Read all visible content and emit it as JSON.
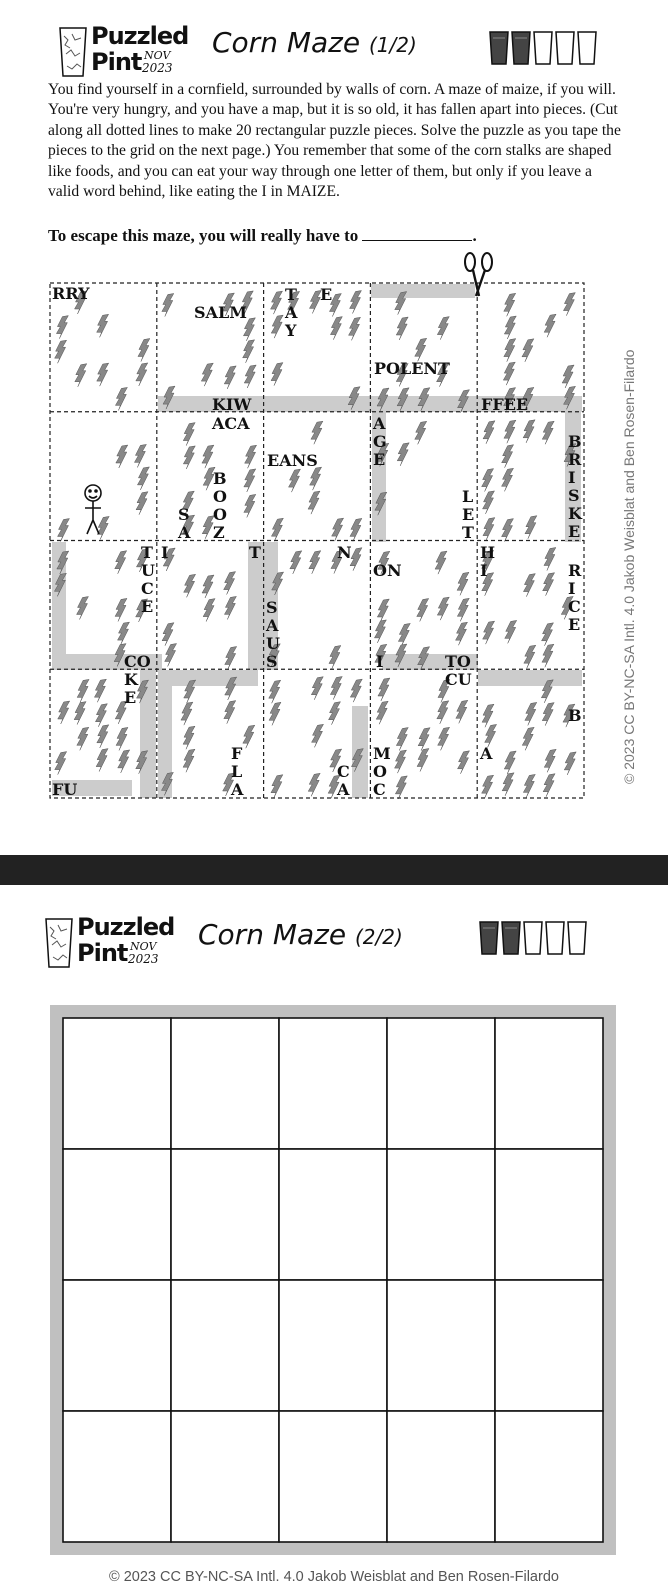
{
  "page1": {
    "logo": {
      "line1": "Puzzled",
      "line2": "Pint",
      "month": "NOV",
      "year": "2023"
    },
    "title": "Corn Maze",
    "part": "(1/2)",
    "difficulty": {
      "filled": 2,
      "total": 5
    },
    "intro": "You find yourself in a cornfield, surrounded by walls of corn. A maze of maize, if you will. You're very hungry, and you have a map, but it is so old, it has fallen apart into pieces. (Cut along all dotted lines to make 20 rectangular puzzle pieces. Solve the puzzle as you tape the pieces to the grid on the next page.) You remember that some of the corn stalks are shaped like foods, and you can eat your way through one letter of them, but only if you leave a valid word behind, like eating the I in MAIZE.",
    "tagline": "To escape this maze, you will really have to",
    "tagline_end": ".",
    "credit": "© 2023 CC BY-NC-SA Intl. 4.0  Jakob Weisblat and Ben Rosen-Filardo",
    "maze_words": {
      "r0c0": "RRY",
      "r0c1": "SALM",
      "r0c2_a": "T",
      "r0c2_b": "A",
      "r0c2_c": "Y",
      "r0c2_d": "E",
      "r0c3": "POLENT",
      "r0c3_b": "KIW",
      "r0c4": "FFEE",
      "r1c1": "ACA",
      "r1c2": "EANS",
      "r1c3_a": "A",
      "r1c3_b": "G",
      "r1c3_c": "E",
      "r1c1_b": "B",
      "r1c1_c": "O",
      "r1c1_d": "O",
      "r1c1_e": "Z",
      "r1c1_s": "S",
      "r1c1_a": "A",
      "r1c4_l": "L",
      "r1c4_e": "E",
      "r1c4_t": "T",
      "r1c4_b": "B",
      "r1c4_r": "R",
      "r1c4_i": "I",
      "r1c4_s": "S",
      "r1c4_k": "K",
      "r1c4_e2": "E",
      "r2c0_t": "T",
      "r2c0_u": "U",
      "r2c0_c": "C",
      "r2c0_e": "E",
      "r2c1_i": "I",
      "r2c1_t": "T",
      "r2c2_n": "N",
      "r2c2_s": "S",
      "r2c2_a": "A",
      "r2c2_u": "U",
      "r2c2_s2": "S",
      "r2c3_on": "ON",
      "r2c4_h": "H",
      "r2c4_i": "I",
      "r2c4_r": "R",
      "r2c4_i2": "I",
      "r2c4_c": "C",
      "r2c4_e": "E",
      "r2c0_co": "CO",
      "r2c3_i": "I",
      "r2c3_to": "TO",
      "r3c3_cu": "CU",
      "r3c0_k": "K",
      "r3c0_e": "E",
      "r3c4_b": "B",
      "r3c1_f": "F",
      "r3c1_l": "L",
      "r3c1_a": "A",
      "r3c2_c": "C",
      "r3c2_a": "A",
      "r3c3_m": "M",
      "r3c3_o": "O",
      "r3c3_c": "C",
      "r3c4_a": "A",
      "r3c0_fu": "FU"
    }
  },
  "page2": {
    "logo": {
      "line1": "Puzzled",
      "line2": "Pint",
      "month": "NOV",
      "year": "2023"
    },
    "title": "Corn Maze",
    "part": "(2/2)",
    "difficulty": {
      "filled": 2,
      "total": 5
    },
    "answer_grid": {
      "rows": 4,
      "cols": 5
    },
    "footer": "© 2023 CC BY-NC-SA Intl. 4.0  Jakob Weisblat and Ben Rosen-Filardo"
  },
  "colors": {
    "corn": "#8a8a8a",
    "wall_shade": "#cccccc",
    "frame": "#c0c0c0",
    "divider": "#222222"
  },
  "icons": {
    "scissors": "scissors-icon",
    "stick_figure": "stick-figure-icon",
    "beer_glass": "beer-glass-icon"
  }
}
